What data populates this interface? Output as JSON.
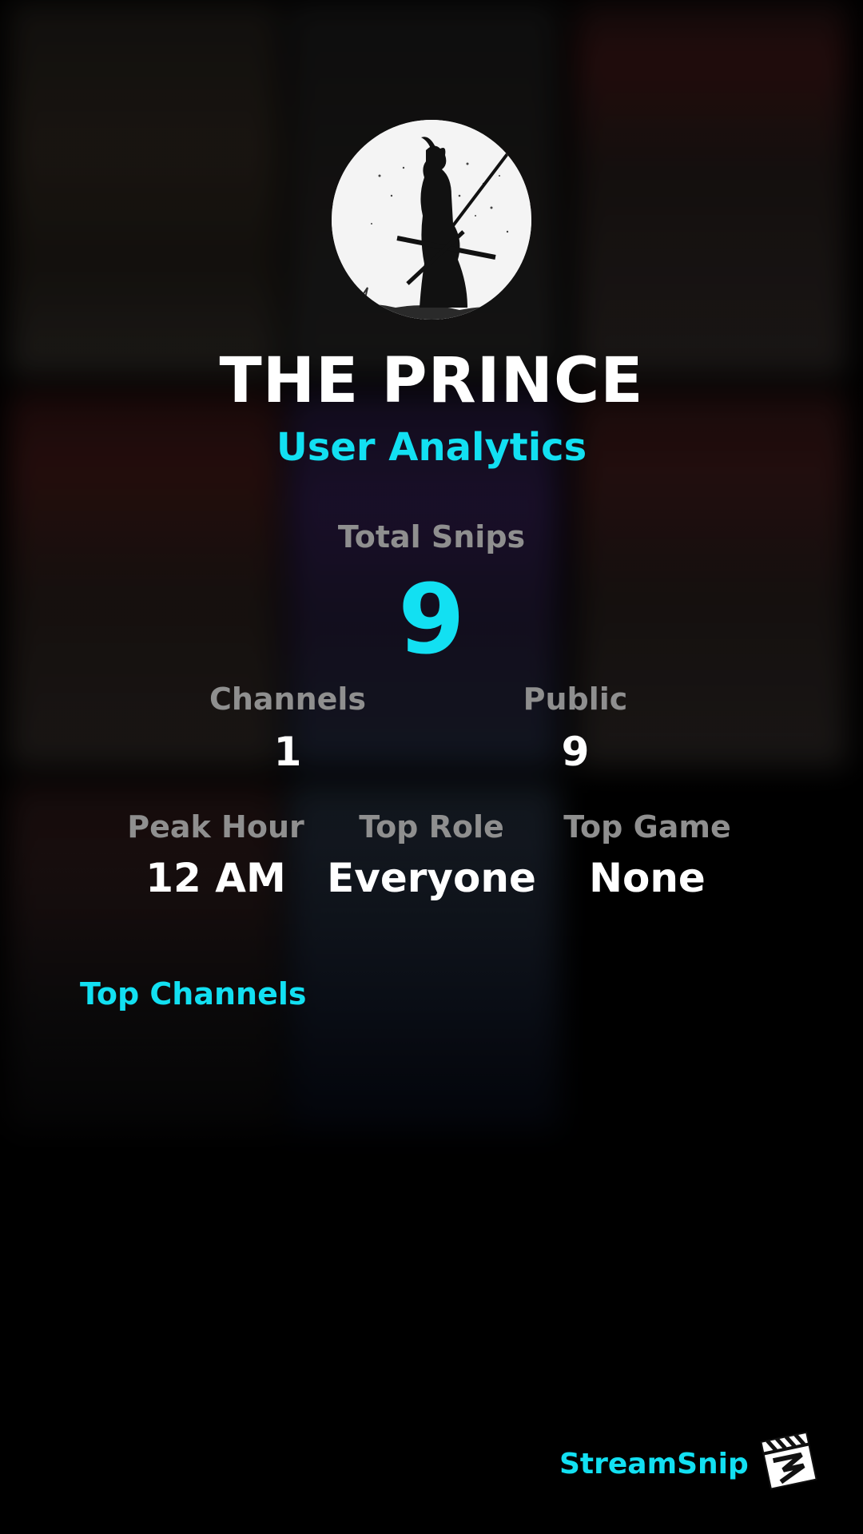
{
  "profile": {
    "username": "THE PRINCE",
    "subtitle": "User Analytics",
    "avatar_icon": "samurai-silhouette-avatar"
  },
  "stats": {
    "total_snips": {
      "label": "Total Snips",
      "value": "9"
    },
    "channels": {
      "label": "Channels",
      "value": "1"
    },
    "public": {
      "label": "Public",
      "value": "9"
    },
    "peak_hour": {
      "label": "Peak Hour",
      "value": "12 AM"
    },
    "top_role": {
      "label": "Top Role",
      "value": "Everyone"
    },
    "top_game": {
      "label": "Top Game",
      "value": "None"
    }
  },
  "sections": {
    "top_channels_title": "Top Channels"
  },
  "footer": {
    "brand": "StreamSnip",
    "brand_icon": "clapperboard-logo-icon"
  },
  "colors": {
    "accent": "#12e0f2",
    "label_gray": "#8f8f8f",
    "text": "#ffffff",
    "background": "#000000"
  }
}
